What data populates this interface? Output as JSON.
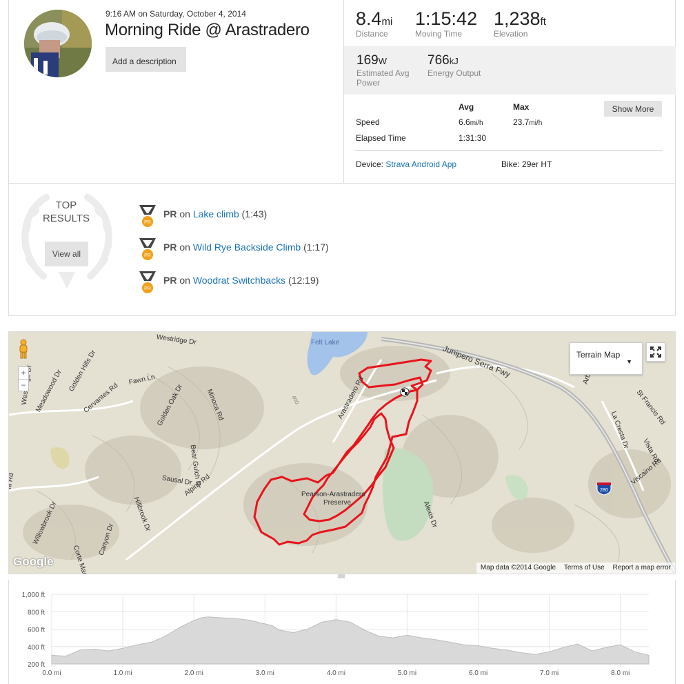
{
  "activity": {
    "datetime_time": "9:16 AM",
    "datetime_rest": "on Saturday, October 4, 2014",
    "title": "Morning Ride @ Arastradero",
    "add_description_label": "Add a description"
  },
  "stats": {
    "distance": {
      "value": "8.4",
      "unit": "mi",
      "label": "Distance"
    },
    "moving_time": {
      "value": "1:15:42",
      "label": "Moving Time"
    },
    "elevation": {
      "value": "1,238",
      "unit": "ft",
      "label": "Elevation"
    },
    "power": {
      "value": "169",
      "unit": "W",
      "label_line1": "Estimated Avg",
      "label_line2": "Power"
    },
    "energy": {
      "value": "766",
      "unit": "kJ",
      "label": "Energy Output"
    }
  },
  "details": {
    "avg_header": "Avg",
    "max_header": "Max",
    "show_more_label": "Show More",
    "speed_label": "Speed",
    "speed_avg": "6.6",
    "speed_avg_unit": "mi/h",
    "speed_max": "23.7",
    "speed_max_unit": "mi/h",
    "elapsed_label": "Elapsed Time",
    "elapsed_value": "1:31:30",
    "device_label": "Device:",
    "device_value": "Strava Android App",
    "bike_label": "Bike:",
    "bike_value": "29er HT"
  },
  "top_results": {
    "title_line1": "TOP",
    "title_line2": "RESULTS",
    "view_all_label": "View all",
    "medal_text": "PR",
    "items": [
      {
        "badge": "PR",
        "on": "on",
        "segment": "Lake climb",
        "time": "(1:43)"
      },
      {
        "badge": "PR",
        "on": "on",
        "segment": "Wild Rye Backside Climb",
        "time": "(1:17)"
      },
      {
        "badge": "PR",
        "on": "on",
        "segment": "Woodrat Switchbacks",
        "time": "(12:19)"
      }
    ]
  },
  "map": {
    "type_button_label": "Terrain Map",
    "google_logo": "Google",
    "footer": [
      "Map data ©2014 Google",
      "Terms of Use",
      "Report a map error"
    ],
    "zoom_in": "+",
    "zoom_out": "−",
    "shield_number": "280",
    "labels": {
      "westridge": "Westridge Dr",
      "felt_lake": "Felt Lake",
      "junipero": "Junipero Serra Fwy",
      "westridge2": "Westridge Dr",
      "meadowood": "Meadowood Dr",
      "golden_hills": "Golden Hills Dr",
      "fawn": "Fawn Ln",
      "minoca": "Minoca Rd",
      "cervantes": "Cervantes Rd",
      "golden_oak": "Golden Oak Dr",
      "bear_gulch": "Bear Gulch Dr",
      "sausal": "Sausal Dr",
      "hillbrook": "Hillbrook Dr",
      "alpine": "Alpine Rd",
      "arastradero": "Arastradero Rd",
      "preserve1": "Pearson-Arastradero",
      "preserve2": "Preserve",
      "alexis": "Alexis Dr",
      "la_cresta": "La Cresta Dr",
      "st_francis": "St Francis Rd",
      "vista": "Vista Rd",
      "viscaino": "Viscaino Rd",
      "arbol": "Arbol Rd",
      "la_rd": "la Rd",
      "willowbrook": "Willowbrook Dr",
      "corte_madera": "Corte Madera Rd",
      "canyon": "Canyon Dr",
      "contour": "400"
    },
    "colors": {
      "route": "#e8141c",
      "water": "#a4c3ea",
      "park": "#c4dcc0",
      "land": "#e7e3d6"
    }
  },
  "elevation_chart": {
    "y_ticks": [
      "1,000 ft",
      "800 ft",
      "600 ft",
      "400 ft",
      "200 ft"
    ],
    "x_ticks": [
      "0.0 mi",
      "1.0 mi",
      "2.0 mi",
      "3.0 mi",
      "4.0 mi",
      "5.0 mi",
      "6.0 mi",
      "7.0 mi",
      "8.0 mi"
    ]
  },
  "chart_data": {
    "type": "area",
    "xlabel": "",
    "ylabel": "",
    "xlim": [
      0,
      8.4
    ],
    "ylim": [
      200,
      1000
    ],
    "x_unit": "mi",
    "y_unit": "ft",
    "grid": true,
    "x": [
      0.0,
      0.2,
      0.4,
      0.6,
      0.8,
      1.0,
      1.2,
      1.4,
      1.6,
      1.8,
      2.0,
      2.1,
      2.2,
      2.4,
      2.6,
      2.8,
      3.0,
      3.1,
      3.2,
      3.4,
      3.6,
      3.8,
      4.0,
      4.2,
      4.4,
      4.6,
      4.8,
      5.0,
      5.2,
      5.4,
      5.6,
      5.8,
      6.0,
      6.2,
      6.4,
      6.6,
      6.8,
      7.0,
      7.2,
      7.4,
      7.6,
      7.8,
      8.0,
      8.2,
      8.4
    ],
    "y": [
      300,
      290,
      360,
      370,
      350,
      380,
      420,
      450,
      520,
      620,
      700,
      730,
      740,
      730,
      720,
      700,
      660,
      640,
      590,
      560,
      600,
      680,
      710,
      680,
      590,
      520,
      500,
      530,
      500,
      480,
      450,
      420,
      410,
      380,
      360,
      330,
      310,
      340,
      390,
      430,
      350,
      390,
      420,
      340,
      300
    ]
  }
}
